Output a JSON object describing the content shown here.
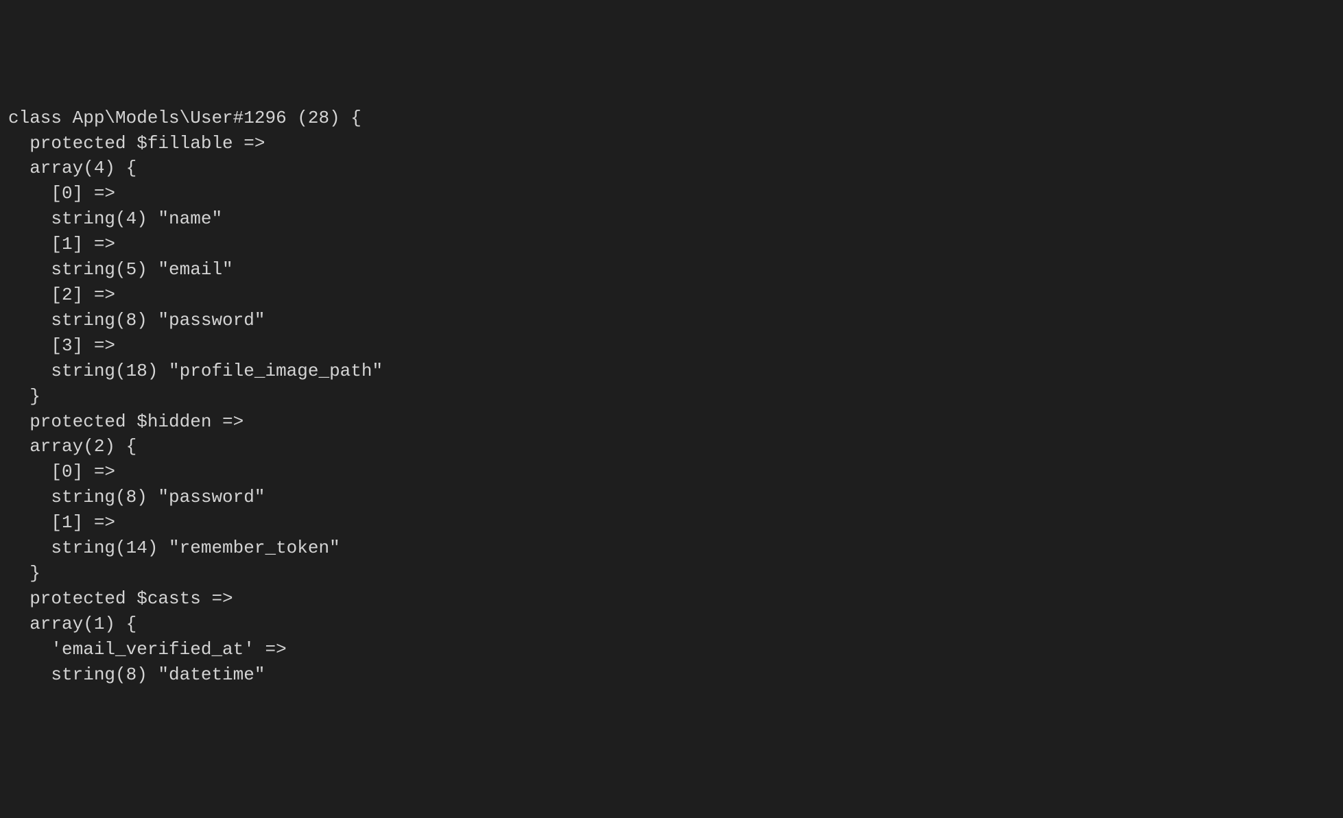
{
  "lines": [
    "class App\\Models\\User#1296 (28) {",
    "  protected $fillable =>",
    "  array(4) {",
    "    [0] =>",
    "    string(4) \"name\"",
    "    [1] =>",
    "    string(5) \"email\"",
    "    [2] =>",
    "    string(8) \"password\"",
    "    [3] =>",
    "    string(18) \"profile_image_path\"",
    "  }",
    "  protected $hidden =>",
    "  array(2) {",
    "    [0] =>",
    "    string(8) \"password\"",
    "    [1] =>",
    "    string(14) \"remember_token\"",
    "  }",
    "  protected $casts =>",
    "  array(1) {",
    "    'email_verified_at' =>",
    "    string(8) \"datetime\""
  ]
}
